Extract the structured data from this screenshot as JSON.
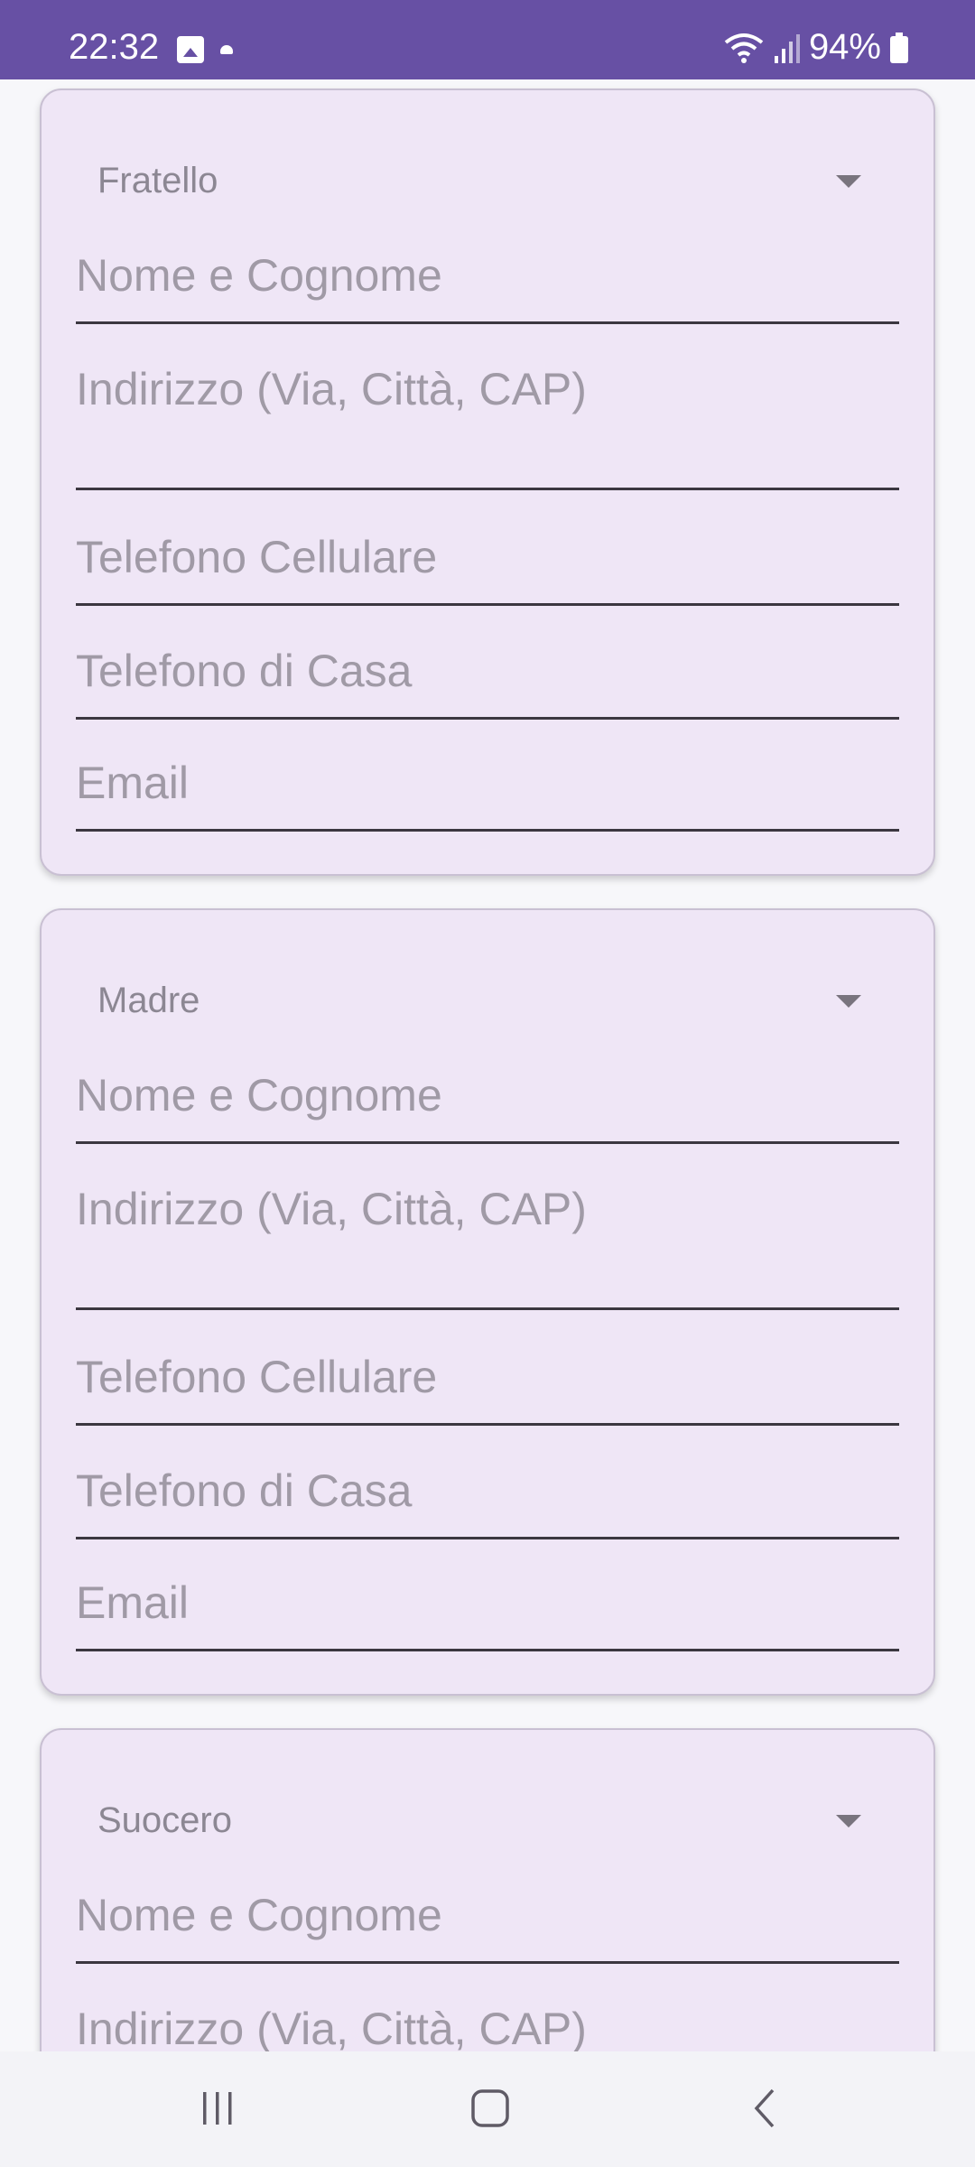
{
  "status_bar": {
    "time": "22:32",
    "battery": "94%",
    "icons": [
      "image-icon",
      "dot-icon",
      "wifi-icon",
      "signal-icon",
      "battery-icon"
    ]
  },
  "cards": [
    {
      "relation": "Fratello",
      "fields": {
        "name": "Nome e Cognome",
        "address": "Indirizzo (Via, Città, CAP)",
        "mobile": "Telefono Cellulare",
        "home": "Telefono di Casa",
        "email": "Email"
      }
    },
    {
      "relation": "Madre",
      "fields": {
        "name": "Nome e Cognome",
        "address": "Indirizzo (Via, Città, CAP)",
        "mobile": "Telefono Cellulare",
        "home": "Telefono di Casa",
        "email": "Email"
      }
    },
    {
      "relation": "Suocero",
      "fields": {
        "name": "Nome e Cognome",
        "address": "Indirizzo (Via, Città, CAP)"
      }
    }
  ],
  "navigation": {
    "buttons": [
      "recents-icon",
      "home-icon",
      "back-icon"
    ]
  },
  "colors": {
    "status_bar": "#6750a4",
    "card_background": "#efe6f6",
    "placeholder_text": "#a09aa6"
  }
}
